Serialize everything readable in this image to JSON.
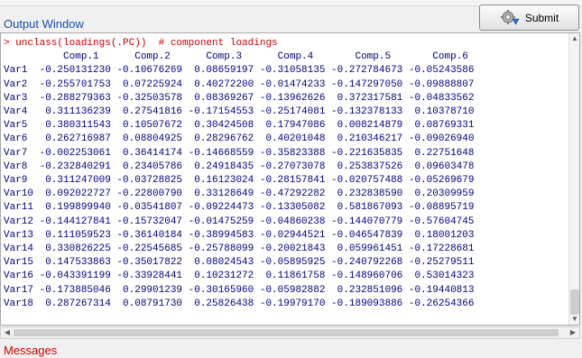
{
  "output_window": {
    "title": "Output Window"
  },
  "toolbar": {
    "submit_label": "Submit"
  },
  "console": {
    "command": "> unclass(loadings(.PC))  # component loadings",
    "header": "          Comp.1      Comp.2      Comp.3      Comp.4       Comp.5       Comp.6",
    "rows": [
      "Var1  -0.250131230 -0.10676269  0.08659197 -0.31058135 -0.272784673 -0.05243586",
      "Var2  -0.255701753  0.07225924  0.40272200 -0.01474233 -0.147297050 -0.09888807",
      "Var3  -0.288279363 -0.32503578  0.08369267 -0.13962626  0.372317581 -0.04833562",
      "Var4   0.311136239  0.27541816 -0.17154553 -0.25174081 -0.132378133  0.10378710",
      "Var5   0.380311543  0.10507672  0.30424508  0.17947086  0.008214879  0.08769331",
      "Var6   0.262716987  0.08804925  0.28296762  0.40201048  0.210346217 -0.09026940",
      "Var7  -0.002253061  0.36414174 -0.14668559 -0.35823388 -0.221635835  0.22751648",
      "Var8  -0.232840291  0.23405786  0.24918435 -0.27073078  0.253837526  0.09603478",
      "Var9   0.311247009 -0.03728825  0.16123024 -0.28157841 -0.020757488 -0.05269679",
      "Var10  0.092022727 -0.22800790  0.33128649 -0.47292282  0.232838590  0.20309959",
      "Var11  0.199899940 -0.03541807 -0.09224473 -0.13305082  0.581867093 -0.08895719",
      "Var12 -0.144127841 -0.15732047 -0.01475259 -0.04860238 -0.144070779 -0.57604745",
      "Var13  0.111059523 -0.36140184 -0.38994583 -0.02944521 -0.046547839  0.18001203",
      "Var14  0.330826225 -0.22545685 -0.25788099 -0.20021843  0.059961451 -0.17228681",
      "Var15  0.147533863 -0.35017822  0.08024543 -0.05895925 -0.240792268 -0.25279511",
      "Var16 -0.043391199 -0.33928441  0.10231272  0.11861758 -0.148960706  0.53014323",
      "Var17 -0.173885046  0.29901239 -0.30165960 -0.05982882  0.232851096 -0.19440813",
      "Var18  0.287267314  0.08791730  0.25826438 -0.19979170 -0.189093886 -0.26254366"
    ]
  },
  "messages": {
    "title": "Messages"
  },
  "colors": {
    "command": "#cc0000",
    "output": "#000080",
    "messages_title": "#cc0000",
    "output_title": "#1a4fb0"
  },
  "icons": {
    "submit": "gear-submit-icon",
    "scroll_up": "up-arrow-icon",
    "scroll_down": "down-arrow-icon",
    "scroll_left": "left-arrow-icon",
    "scroll_right": "right-arrow-icon"
  }
}
